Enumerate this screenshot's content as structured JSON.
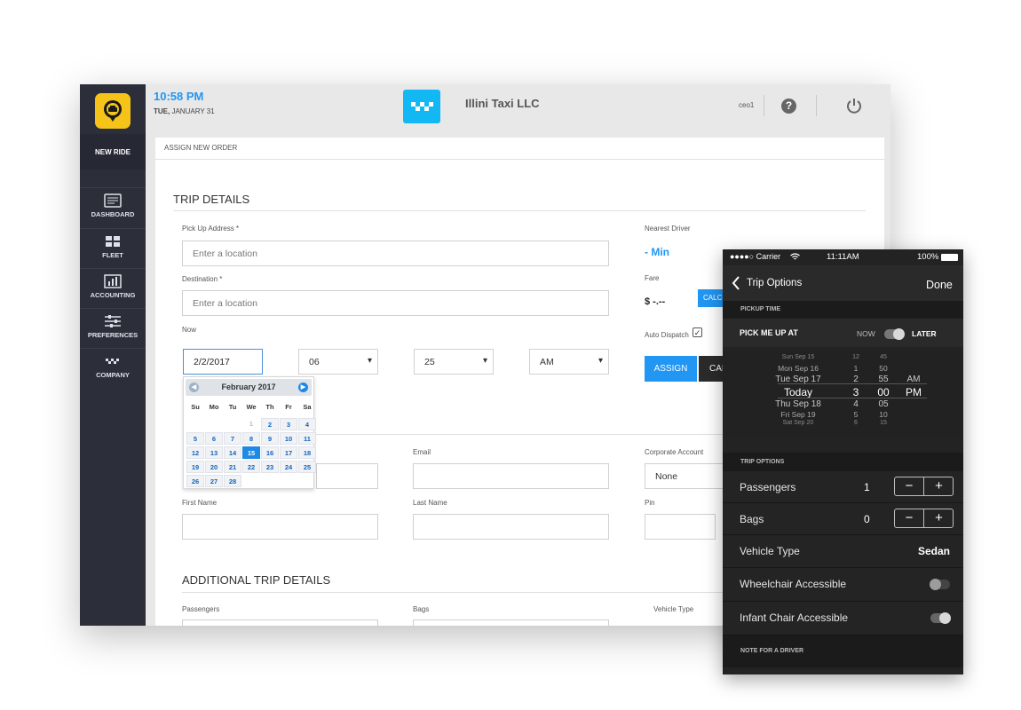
{
  "topbar": {
    "time": "10:58 PM",
    "day": "TUE,",
    "date": "JANUARY 31",
    "company": "Illini Taxi LLC",
    "user": "ceo1",
    "help_glyph": "?"
  },
  "sidebar": {
    "new_ride": "NEW RIDE",
    "items": [
      {
        "label": "DASHBOARD",
        "icon": "dashboard-icon"
      },
      {
        "label": "FLEET",
        "icon": "fleet-icon"
      },
      {
        "label": "ACCOUNTING",
        "icon": "accounting-icon"
      },
      {
        "label": "PREFERENCES",
        "icon": "preferences-icon"
      },
      {
        "label": "COMPANY",
        "icon": "company-icon"
      }
    ]
  },
  "breadcrumb": "ASSIGN NEW ORDER",
  "trip": {
    "title": "TRIP DETAILS",
    "pickup_label": "Pick Up Address *",
    "pickup_placeholder": "Enter a location",
    "dest_label": "Destination *",
    "dest_placeholder": "Enter a location",
    "when_label": "Now",
    "date_value": "2/2/2017",
    "hour": "06",
    "minute": "25",
    "ampm": "AM"
  },
  "driver": {
    "nearest_label": "Nearest Driver",
    "nearest_value": "- Min",
    "fare_label": "Fare",
    "fare_value": "$ -.--",
    "calc_label": "CALC",
    "auto_label": "Auto Dispatch",
    "auto_check": "✓",
    "assign_label": "ASSIGN",
    "cancel_label": "CAN"
  },
  "calendar": {
    "month": "February 2017",
    "prev": "◀",
    "next": "▶",
    "weekdays": [
      "Su",
      "Mo",
      "Tu",
      "We",
      "Th",
      "Fr",
      "Sa"
    ],
    "weeks": [
      [
        "",
        "",
        "",
        "1",
        "2",
        "3",
        "4"
      ],
      [
        "5",
        "6",
        "7",
        "8",
        "9",
        "10",
        "11"
      ],
      [
        "12",
        "13",
        "14",
        "15",
        "16",
        "17",
        "18"
      ],
      [
        "19",
        "20",
        "21",
        "22",
        "23",
        "24",
        "25"
      ],
      [
        "26",
        "27",
        "28",
        "",
        "",
        "",
        ""
      ]
    ],
    "selected": "15"
  },
  "customer": {
    "email_label": "Email",
    "corp_label": "Corporate Account",
    "corp_value": "None",
    "first_label": "First Name",
    "last_label": "Last Name",
    "pin_label": "Pin"
  },
  "additional": {
    "title": "ADDITIONAL TRIP DETAILS",
    "passengers_label": "Passengers",
    "bags_label": "Bags",
    "vehicle_label": "Vehicle Type"
  },
  "phone": {
    "carrier": "●●●●○ Carrier",
    "clock": "11:11AM",
    "battery": "100%",
    "back_label": "Trip Options",
    "done_label": "Done",
    "pickup_header": "PICKUP TIME",
    "pick_label": "PICK ME UP AT",
    "now_label": "NOW",
    "later_label": "LATER",
    "picker_days": [
      "Sun Sep 15",
      "Mon Sep 16",
      "Tue Sep 17",
      "Today",
      "Thu Sep 18",
      "Fri Sep 19",
      "Sat Sep 20"
    ],
    "picker_hours": [
      "12",
      "1",
      "2",
      "3",
      "4",
      "5",
      "6"
    ],
    "picker_minutes": [
      "45",
      "50",
      "55",
      "00",
      "05",
      "10",
      "15"
    ],
    "picker_ampm": [
      "AM",
      "PM"
    ],
    "options_header": "TRIP OPTIONS",
    "passengers_label": "Passengers",
    "passengers_value": "1",
    "bags_label": "Bags",
    "bags_value": "0",
    "minus": "−",
    "plus": "+",
    "vehicle_label": "Vehicle Type",
    "vehicle_value": "Sedan",
    "wheelchair_label": "Wheelchair Accessible",
    "infant_label": "Infant Chair Accessible",
    "note_header": "NOTE FOR A DRIVER",
    "toggles": {
      "later": true,
      "wheelchair": false,
      "infant": true
    }
  },
  "colors": {
    "accent": "#2196f3",
    "sidebar": "#2c2f3a",
    "logo": "#f6c419",
    "brand": "#12b8f4"
  }
}
